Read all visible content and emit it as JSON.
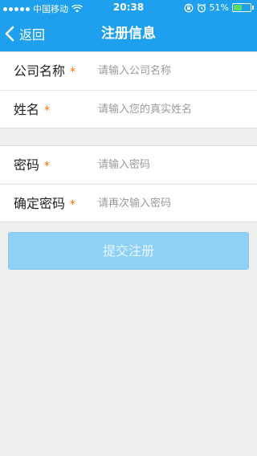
{
  "status_bar": {
    "carrier": "中国移动",
    "time": "20:38",
    "battery_percent": "51%",
    "battery_level": 0.51,
    "icons": [
      "signal-dots-icon",
      "wifi-icon",
      "rotation-lock-icon",
      "alarm-icon",
      "battery-icon"
    ]
  },
  "nav": {
    "back_label": "返回",
    "title": "注册信息"
  },
  "form": {
    "required_mark": "*",
    "company": {
      "label": "公司名称",
      "placeholder": "请输入公司名称",
      "value": ""
    },
    "name": {
      "label": "姓名",
      "placeholder": "请输入您的真实姓名",
      "value": ""
    },
    "password": {
      "label": "密码",
      "placeholder": "请输入密码",
      "value": ""
    },
    "confirm_password": {
      "label": "确定密码",
      "placeholder": "请再次输入密码",
      "value": ""
    }
  },
  "submit": {
    "label": "提交注册"
  },
  "colors": {
    "header_bg": "#1ea0ee",
    "required": "#ff6a00",
    "submit_bg": "#8fd1f6",
    "page_bg": "#efefef"
  }
}
